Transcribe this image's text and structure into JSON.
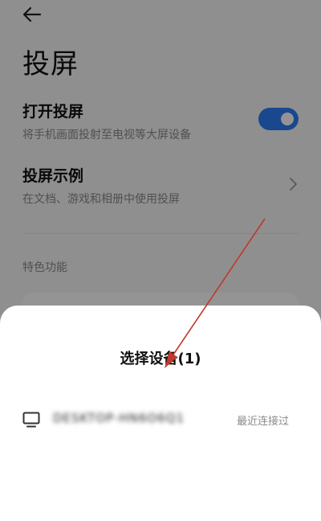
{
  "header": {
    "back_icon": "arrow-left-icon",
    "title": "投屏"
  },
  "settings": {
    "cast": {
      "title": "打开投屏",
      "description": "将手机画面投射至电视等大屏设备",
      "toggle_on": true
    },
    "example": {
      "title": "投屏示例",
      "description": "在文档、游戏和相册中使用投屏",
      "chevron_icon": "chevron-right-icon"
    }
  },
  "section": {
    "features_label": "特色功能"
  },
  "sheet": {
    "title": "选择设备(1)",
    "devices": [
      {
        "icon": "monitor-icon",
        "name": "DESKTOP-HN6O6Q1",
        "status": "最近连接过"
      }
    ]
  },
  "colors": {
    "accent": "#2e7cf6",
    "annotation_arrow": "#c0392b"
  }
}
